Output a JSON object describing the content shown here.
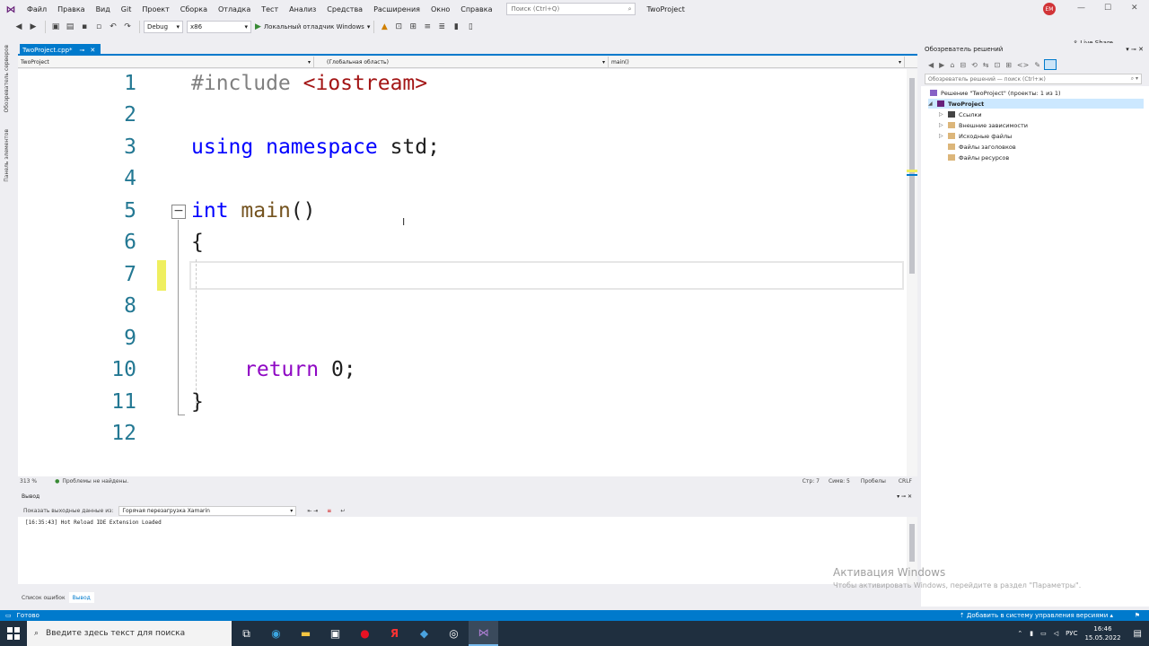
{
  "menu": {
    "items": [
      "Файл",
      "Правка",
      "Вид",
      "Git",
      "Проект",
      "Сборка",
      "Отладка",
      "Тест",
      "Анализ",
      "Средства",
      "Расширения",
      "Окно",
      "Справка"
    ],
    "search_placeholder": "Поиск (Ctrl+Q)",
    "solution_title": "TwoProject",
    "avatar_initials": "EM"
  },
  "toolbar": {
    "config": "Debug",
    "platform": "x86",
    "debugger": "Локальный отладчик Windows",
    "live_share": "Live Share"
  },
  "left_tabs": [
    "Обозреватель серверов",
    "Панель элементов"
  ],
  "document": {
    "tab_label": "TwoProject.cpp*",
    "nav_project": "TwoProject",
    "nav_scope": "(Глобальная область)",
    "nav_member": "main()"
  },
  "code": {
    "lines": [
      "1",
      "2",
      "3",
      "4",
      "5",
      "6",
      "7",
      "8",
      "9",
      "10",
      "11",
      "12"
    ],
    "include_kw": "#include",
    "include_hdr": "<iostream>",
    "using_kw": "using",
    "namespace_kw": "namespace",
    "std_text": " std;",
    "int_kw": "int",
    "main_fn": "main",
    "main_parens": "()",
    "open_brace": "{",
    "return_kw": "return",
    "return_val": " 0;",
    "close_brace": "}"
  },
  "editor_status": {
    "zoom": "313 %",
    "problems": "Проблемы не найдены.",
    "line": "Стр: 7",
    "col": "Симв: 5",
    "spaces": "Пробелы",
    "eol": "CRLF"
  },
  "output": {
    "title": "Вывод",
    "show_from_label": "Показать выходные данные из:",
    "source": "Горячая перезагрузка Xamarin",
    "log": "[16:35:43]  Hot Reload IDE Extension Loaded",
    "tabs": [
      "Список ошибок",
      "Вывод"
    ]
  },
  "solution_explorer": {
    "title": "Обозреватель решений",
    "search_placeholder": "Обозреватель решений — поиск (Ctrl+ж)",
    "solution_node": "Решение \"TwoProject\" (проекты: 1 из 1)",
    "project_node": "TwoProject",
    "children": [
      "Ссылки",
      "Внешние зависимости",
      "Исходные файлы",
      "Файлы заголовков",
      "Файлы ресурсов"
    ]
  },
  "watermark": {
    "title": "Активация Windows",
    "subtitle": "Чтобы активировать Windows, перейдите в раздел \"Параметры\"."
  },
  "statusbar": {
    "ready": "Готово",
    "source_control": "Добавить в систему управления версиями"
  },
  "taskbar": {
    "search_placeholder": "Введите здесь текст для поиска",
    "lang": "РУС",
    "time": "16:46",
    "date": "15.05.2022"
  },
  "colors": {
    "accent": "#007acc",
    "keyword": "#0000ff",
    "string": "#a31515",
    "control": "#8f08c4",
    "linenum": "#237893"
  }
}
